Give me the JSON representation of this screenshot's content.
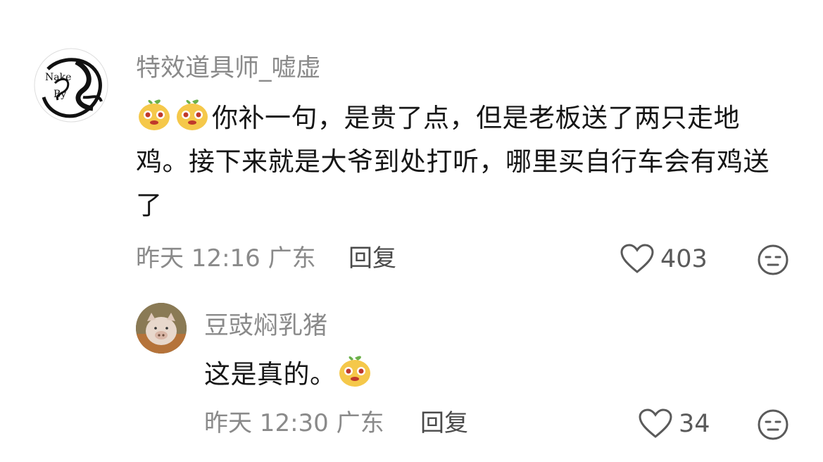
{
  "comments": [
    {
      "username": "特效道具师_嘘虚",
      "text": "你补一句，是贵了点，但是老板送了两只走地鸡。接下来就是大爷到处打听，哪里买自行车会有鸡送了",
      "emoji_count": 2,
      "avatar_icon": "calligraphy-logo-avatar",
      "time": "昨天 12:16",
      "location": "广东",
      "reply_label": "回复",
      "likes": "403",
      "dislike_icon": "unamused-face-icon"
    },
    {
      "username": "豆豉焖乳猪",
      "text": "这是真的。",
      "emoji_count": 1,
      "avatar_icon": "pig-photo-avatar",
      "time": "昨天 12:30",
      "location": "广东",
      "reply_label": "回复",
      "likes": "34",
      "dislike_icon": "unamused-face-icon"
    }
  ],
  "colors": {
    "secondary_text": "#8a8a8a",
    "primary_text": "#161616",
    "emoji_yellow": "#f5c84a",
    "emoji_leaf": "#6bb04a"
  }
}
